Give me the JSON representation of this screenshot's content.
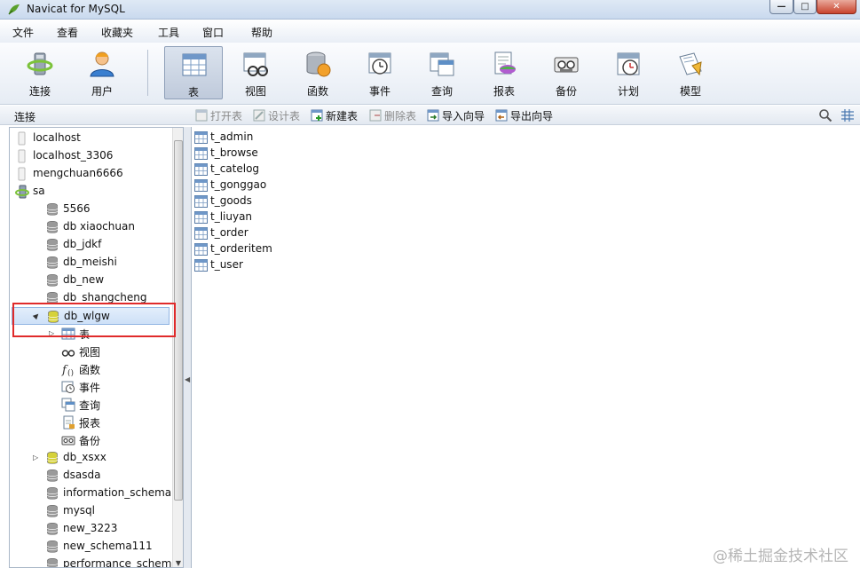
{
  "window": {
    "title": "Navicat for MySQL",
    "min": "—",
    "max": "□",
    "close": "✕"
  },
  "menu": [
    "文件",
    "查看",
    "收藏夹",
    "工具",
    "窗口",
    "帮助"
  ],
  "toolbar": [
    {
      "label": "连接",
      "icon": "connection-icon"
    },
    {
      "label": "用户",
      "icon": "user-icon"
    },
    {
      "label": "表",
      "icon": "table-icon",
      "active": true
    },
    {
      "label": "视图",
      "icon": "view-icon"
    },
    {
      "label": "函数",
      "icon": "function-icon"
    },
    {
      "label": "事件",
      "icon": "event-icon"
    },
    {
      "label": "查询",
      "icon": "query-icon"
    },
    {
      "label": "报表",
      "icon": "report-icon"
    },
    {
      "label": "备份",
      "icon": "backup-icon"
    },
    {
      "label": "计划",
      "icon": "schedule-icon"
    },
    {
      "label": "模型",
      "icon": "model-icon"
    }
  ],
  "subbar": {
    "connection_label": "连接",
    "actions": [
      {
        "label": "打开表",
        "enabled": false
      },
      {
        "label": "设计表",
        "enabled": false
      },
      {
        "label": "新建表",
        "enabled": true
      },
      {
        "label": "删除表",
        "enabled": false
      },
      {
        "label": "导入向导",
        "enabled": true
      },
      {
        "label": "导出向导",
        "enabled": true
      }
    ]
  },
  "tree": [
    {
      "text": "localhost",
      "type": "connection",
      "level": 1
    },
    {
      "text": "localhost_3306",
      "type": "connection",
      "level": 1
    },
    {
      "text": "mengchuan6666",
      "type": "connection",
      "level": 1
    },
    {
      "text": "sa",
      "type": "connection-open",
      "level": 1,
      "twisty": "▲"
    },
    {
      "text": "5566",
      "type": "db",
      "level": 2
    },
    {
      "text": "db xiaochuan",
      "type": "db",
      "level": 2
    },
    {
      "text": "db_jdkf",
      "type": "db",
      "level": 2
    },
    {
      "text": "db_meishi",
      "type": "db",
      "level": 2
    },
    {
      "text": "db_new",
      "type": "db",
      "level": 2
    },
    {
      "text": "db_shangcheng",
      "type": "db",
      "level": 2
    },
    {
      "text": "db_wlgw",
      "type": "db-open",
      "level": 2,
      "twisty": "▲",
      "selected": true
    },
    {
      "text": "表",
      "type": "table-folder",
      "level": 3,
      "twisty": "▷"
    },
    {
      "text": "视图",
      "type": "view-folder",
      "level": 3
    },
    {
      "text": "函数",
      "type": "function-folder",
      "level": 3
    },
    {
      "text": "事件",
      "type": "event-folder",
      "level": 3
    },
    {
      "text": "查询",
      "type": "query-folder",
      "level": 3
    },
    {
      "text": "报表",
      "type": "report-folder",
      "level": 3
    },
    {
      "text": "备份",
      "type": "backup-folder",
      "level": 3
    },
    {
      "text": "db_xsxx",
      "type": "db-open",
      "level": 2,
      "twisty": "▷"
    },
    {
      "text": "dsasda",
      "type": "db",
      "level": 2
    },
    {
      "text": "information_schema",
      "type": "db",
      "level": 2
    },
    {
      "text": "mysql",
      "type": "db",
      "level": 2
    },
    {
      "text": "new_3223",
      "type": "db",
      "level": 2
    },
    {
      "text": "new_schema111",
      "type": "db",
      "level": 2
    },
    {
      "text": "performance_schem",
      "type": "db",
      "level": 2
    }
  ],
  "tables": [
    "t_admin",
    "t_browse",
    "t_catelog",
    "t_gonggao",
    "t_goods",
    "t_liuyan",
    "t_order",
    "t_orderitem",
    "t_user"
  ],
  "watermark": "@稀土掘金技术社区",
  "colors": {
    "accent": "#93b6e3",
    "highlight": "#e02b2b",
    "db_open": "#d6d23a"
  }
}
